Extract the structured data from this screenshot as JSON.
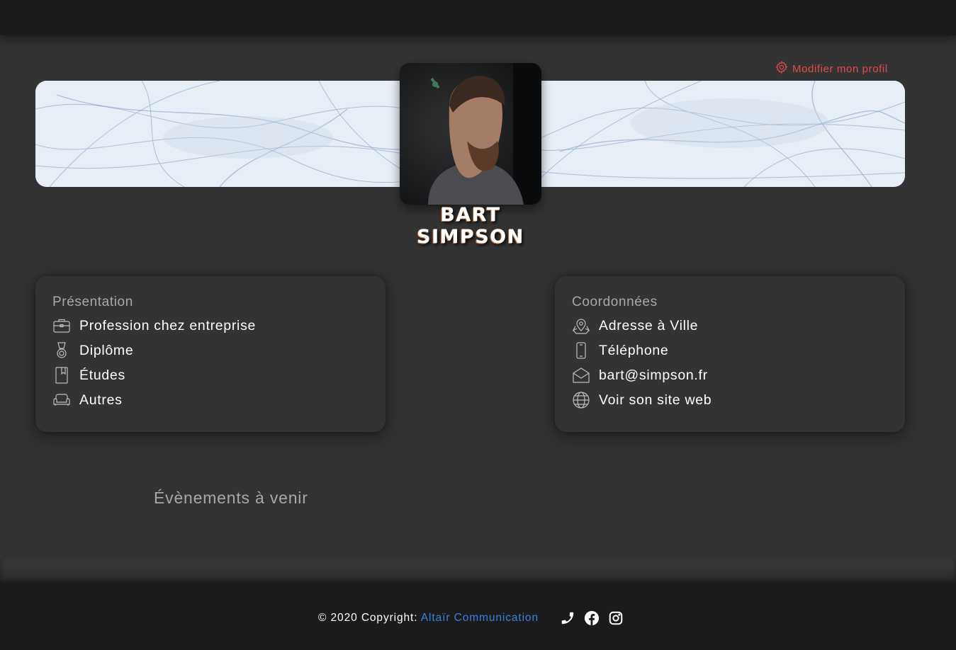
{
  "header": {},
  "profile": {
    "edit_label": "Modifier mon profil",
    "name": "BART SIMPSON"
  },
  "presentation": {
    "title": "Présentation",
    "items": [
      {
        "icon": "briefcase-icon",
        "label": "Profession chez entreprise"
      },
      {
        "icon": "medal-icon",
        "label": "Diplôme"
      },
      {
        "icon": "bookmark-book-icon",
        "label": "Études"
      },
      {
        "icon": "couch-icon",
        "label": "Autres"
      }
    ]
  },
  "contact": {
    "title": "Coordonnées",
    "items": [
      {
        "icon": "map-pin-icon",
        "label": "Adresse à Ville"
      },
      {
        "icon": "phone-icon",
        "label": "Téléphone"
      },
      {
        "icon": "envelope-icon",
        "label": "bart@simpson.fr"
      },
      {
        "icon": "globe-icon",
        "label": "Voir son site web"
      }
    ]
  },
  "events": {
    "title": "Évènements à venir"
  },
  "footer": {
    "copyright_prefix": "© 2020 Copyright: ",
    "company_link": "Altaïr Communication",
    "socials": [
      "phone-icon",
      "facebook-icon",
      "instagram-icon"
    ]
  },
  "colors": {
    "page_background": "#333333",
    "bar_background": "#1b1b1b",
    "edit_link": "#e14b4b",
    "link_blue": "#3d7fe0",
    "muted_text": "#a8a8a8"
  }
}
